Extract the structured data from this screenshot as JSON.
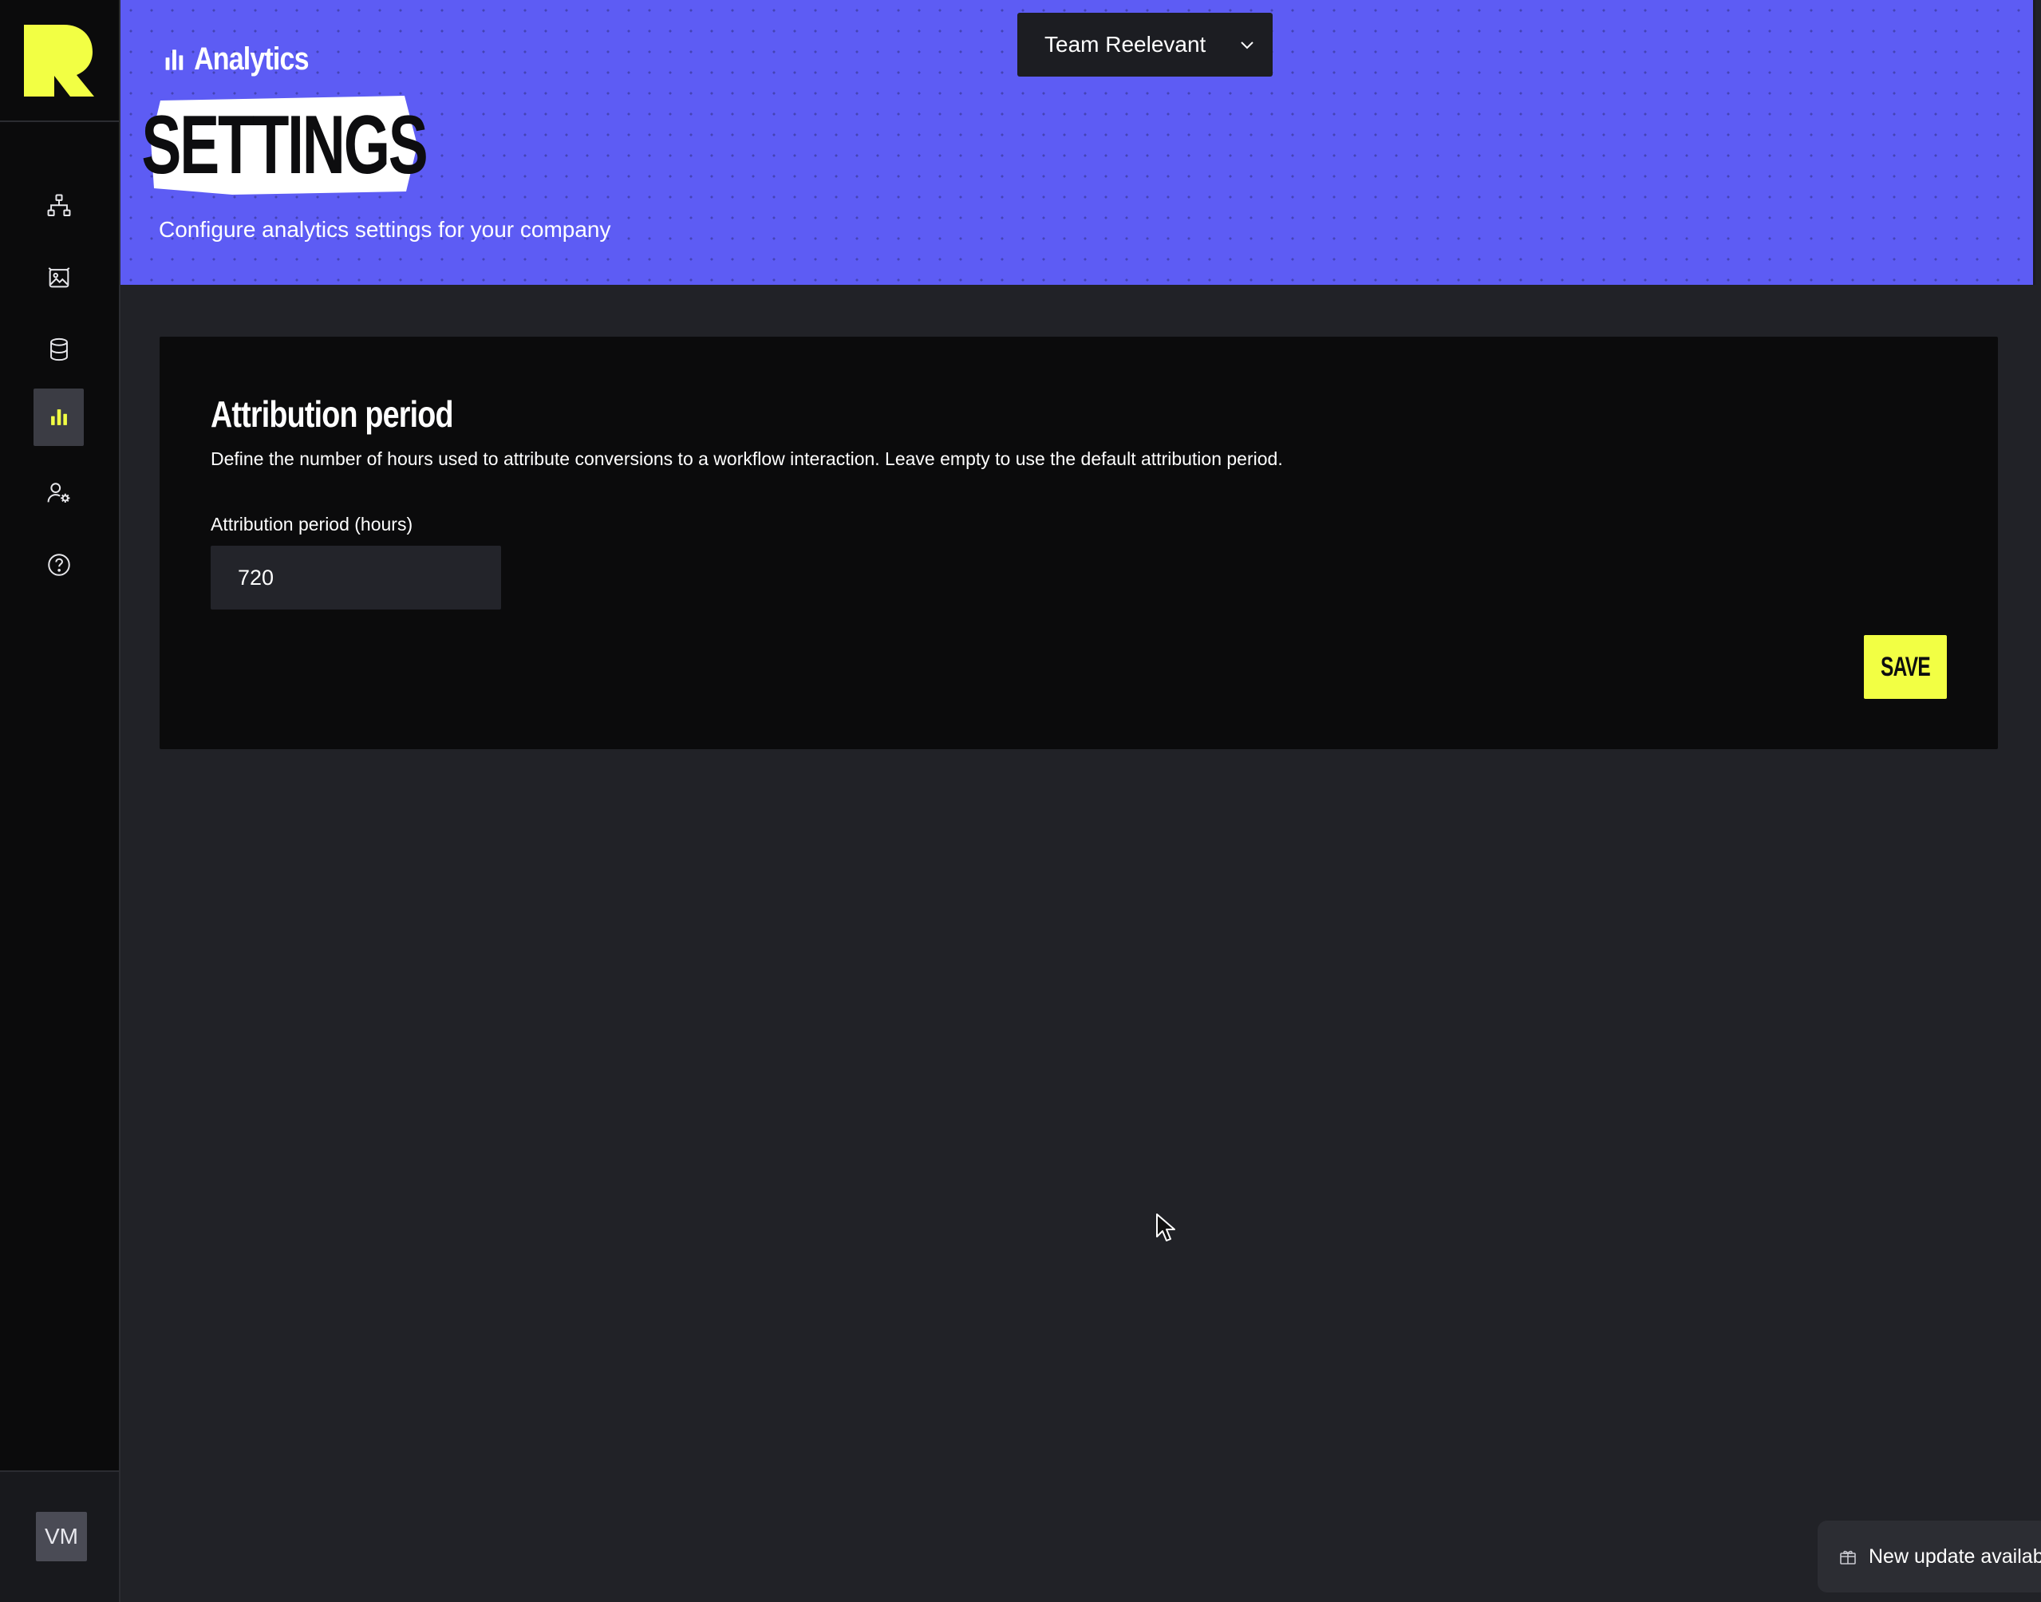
{
  "app": {
    "brand_color": "#f2ff44",
    "header_color": "#5d5cf4"
  },
  "sidebar": {
    "logo": "reelevant-logo",
    "items": [
      {
        "icon": "workflow-icon",
        "active": false
      },
      {
        "icon": "image-gallery-icon",
        "active": false
      },
      {
        "icon": "database-icon",
        "active": false
      },
      {
        "icon": "analytics-icon",
        "active": true
      },
      {
        "icon": "user-settings-icon",
        "active": false
      },
      {
        "icon": "help-icon",
        "active": false
      }
    ],
    "avatar_initials": "VM"
  },
  "header": {
    "section_label": "Analytics",
    "title": "SETTINGS",
    "subtitle": "Configure analytics settings for your company",
    "team_select": {
      "value": "Team Reelevant"
    }
  },
  "attribution": {
    "title": "Attribution period",
    "description": "Define the number of hours used to attribute conversions to a workflow interaction. Leave empty to use the default attribution period.",
    "field_label": "Attribution period (hours)",
    "field_value": "720",
    "save_label": "SAVE"
  },
  "toast": {
    "text": "New update availab"
  }
}
